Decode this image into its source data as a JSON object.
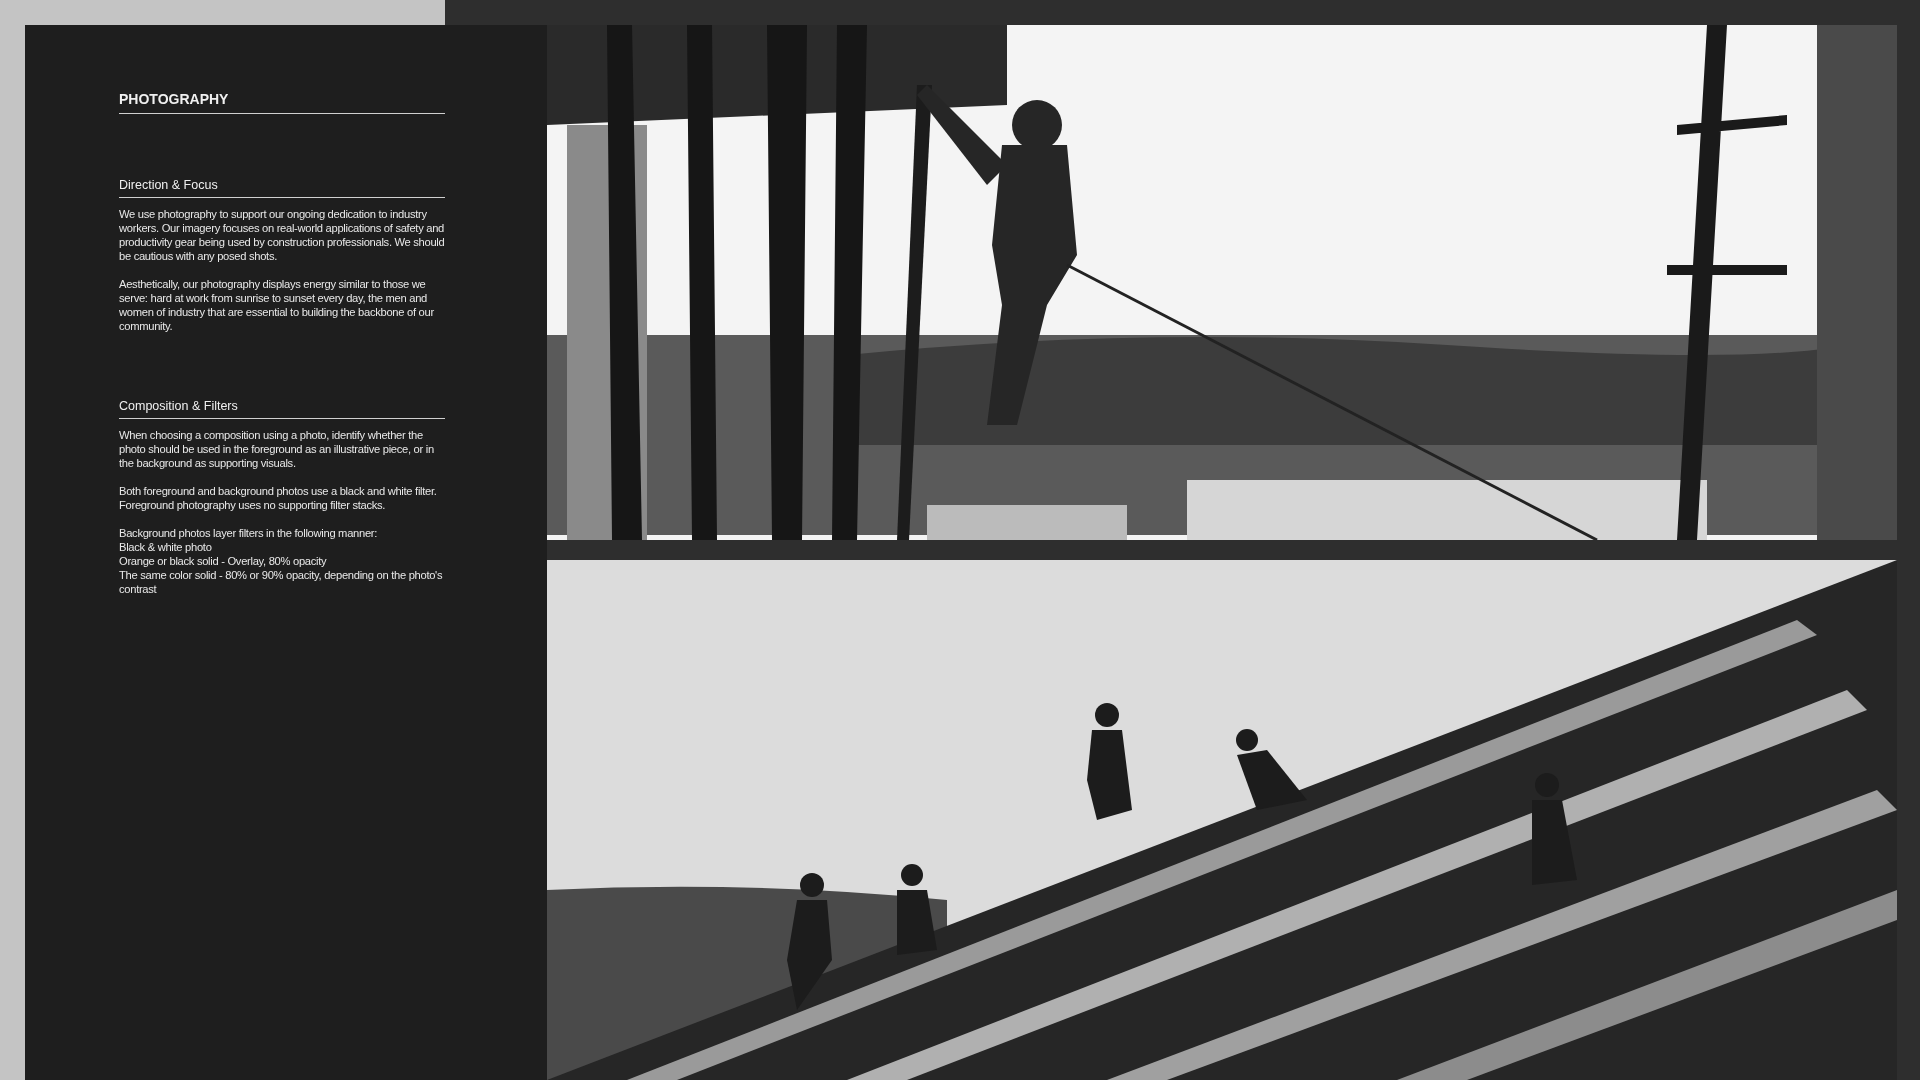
{
  "title": "PHOTOGRAPHY",
  "sections": [
    {
      "heading": "Direction & Focus",
      "paragraphs": [
        "We use photography to support our ongoing dedication to industry workers. Our imagery focuses on real-world applications of safety and productivity gear being used by construction professionals. We should be cautious with any posed shots.",
        "Aesthetically, our photography displays energy similar to those we serve: hard at work from sunrise to sunset every day, the men and women of industry that are essential to building the backbone of our community."
      ]
    },
    {
      "heading": "Composition & Filters",
      "paragraphs": [
        "When choosing a composition using a photo, identify whether the photo should be used in the foreground as an illustrative piece, or in the background as supporting visuals.",
        "Both foreground and background photos use a black and white filter. Foreground photography uses no supporting filter stacks.",
        "Background photos layer filters in the following manner:\nBlack & white photo\nOrange or black solid - Overlay, 80% opacity\nThe same color solid - 80% or 90% opacity, depending on the photo's contrast"
      ]
    }
  ]
}
